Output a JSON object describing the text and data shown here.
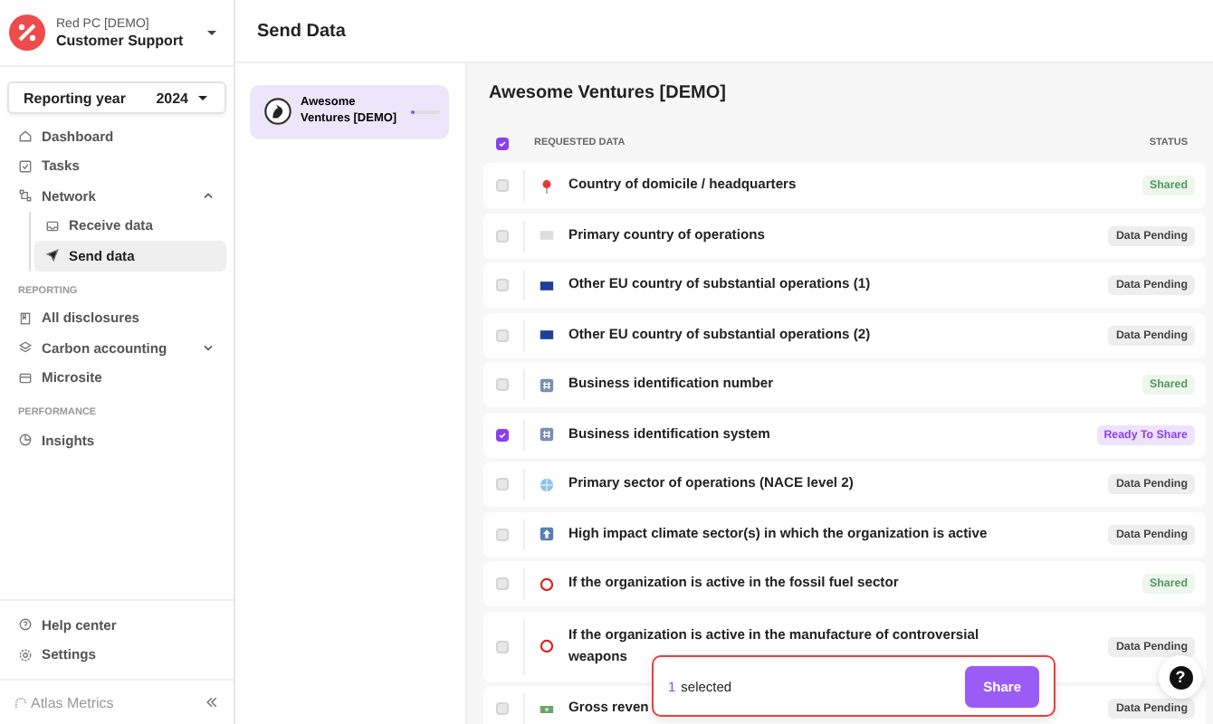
{
  "org": {
    "subtitle": "Red PC [DEMO]",
    "name": "Customer Support"
  },
  "reporting_year": {
    "label": "Reporting year",
    "value": "2024"
  },
  "nav": [
    {
      "kind": "item",
      "label": "Dashboard",
      "selected": false
    },
    {
      "kind": "item",
      "label": "Tasks",
      "selected": false
    },
    {
      "kind": "item",
      "label": "Network",
      "selected": false,
      "expanded": true,
      "children": [
        {
          "label": "Receive data",
          "selected": false
        },
        {
          "label": "Send data",
          "selected": true
        }
      ]
    },
    {
      "kind": "section",
      "label": "REPORTING"
    },
    {
      "kind": "item",
      "label": "All disclosures",
      "selected": false
    },
    {
      "kind": "item",
      "label": "Carbon accounting",
      "selected": false,
      "expanded": false
    },
    {
      "kind": "item",
      "label": "Microsite",
      "selected": false
    },
    {
      "kind": "section",
      "label": "PERFORMANCE"
    },
    {
      "kind": "item",
      "label": "Insights",
      "selected": false
    }
  ],
  "footer_nav": [
    {
      "label": "Help center"
    },
    {
      "label": "Settings"
    }
  ],
  "brand": "Atlas Metrics",
  "page_title": "Send Data",
  "companies": [
    {
      "name": "Awesome Ventures [DEMO]",
      "selected": true,
      "level": 0.1
    }
  ],
  "panel": {
    "title": "Awesome Ventures [DEMO]",
    "all_checked": true,
    "columns": [
      "REQUESTED DATA",
      "STATUS"
    ],
    "rows": [
      {
        "kind": "pin",
        "label": "Country of domicile / headquarters",
        "status": {
          "label": "Shared",
          "kind": "shared"
        },
        "checked": false
      },
      {
        "kind": "flag",
        "label": "Primary country of operations",
        "status": {
          "label": "Data Pending",
          "kind": "pending"
        },
        "checked": false
      },
      {
        "kind": "eu",
        "label": "Other EU country of substantial operations (1)",
        "status": {
          "label": "Data Pending",
          "kind": "pending"
        },
        "checked": false
      },
      {
        "kind": "eu",
        "label": "Other EU country of substantial operations (2)",
        "status": {
          "label": "Data Pending",
          "kind": "pending"
        },
        "checked": false
      },
      {
        "kind": "hash",
        "label": "Business identification number",
        "status": {
          "label": "Shared",
          "kind": "shared"
        },
        "checked": false
      },
      {
        "kind": "hash",
        "label": "Business identification system",
        "status": {
          "label": "Ready To Share",
          "kind": "ready"
        },
        "checked": true
      },
      {
        "kind": "globe",
        "label": "Primary sector of operations (NACE level 2)",
        "status": {
          "label": "Data Pending",
          "kind": "pending"
        },
        "checked": false
      },
      {
        "kind": "up",
        "label": "High impact climate sector(s) in which the organization is active",
        "status": {
          "label": "Data Pending",
          "kind": "pending"
        },
        "checked": false
      },
      {
        "kind": "ring",
        "label": "If the organization is active in the fossil fuel sector",
        "status": {
          "label": "Shared",
          "kind": "shared"
        },
        "checked": false
      },
      {
        "kind": "ring",
        "label": "If the organization is active in the manufacture of controversial weapons",
        "status": {
          "label": "Data Pending",
          "kind": "pending"
        },
        "checked": false
      },
      {
        "kind": "money",
        "label": "Gross reven",
        "status": {
          "label": "Data Pending",
          "kind": "pending"
        },
        "checked": false
      }
    ]
  },
  "selection_bar": {
    "count": "1",
    "text": "selected",
    "button": "Share"
  },
  "help_button": "?"
}
